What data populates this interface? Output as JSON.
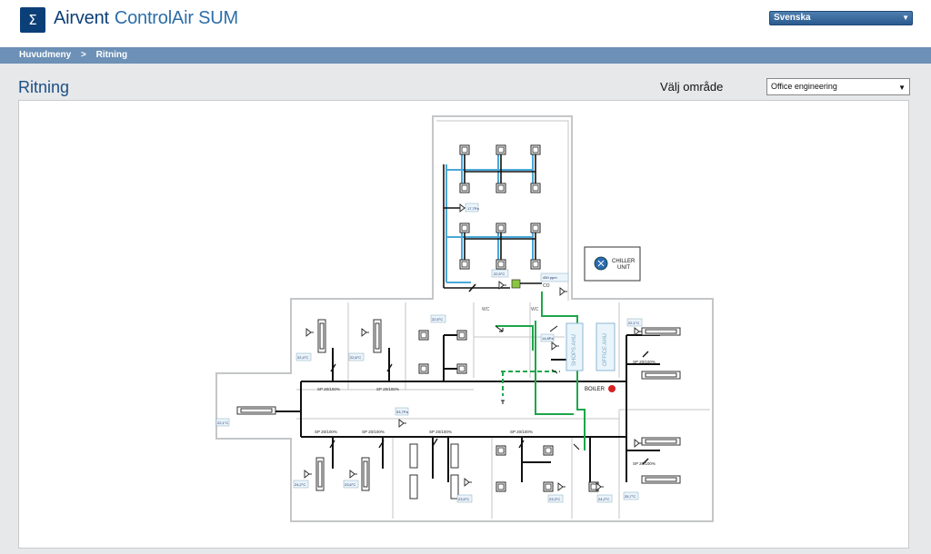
{
  "header": {
    "logo_symbol": "Σ",
    "brand_primary": "Airvent",
    "brand_secondary": "ControlAir SUM",
    "language_selected": "Svenska"
  },
  "breadcrumb": {
    "home": "Huvudmeny",
    "separator": ">",
    "current": "Ritning"
  },
  "page": {
    "title": "Ritning",
    "area_label": "Välj område",
    "area_selected": "Office engineering"
  },
  "drawing": {
    "chiller_line1": "CHILLER",
    "chiller_line2": "UNIT",
    "boiler_label": "BOILER",
    "wc_label": "WC",
    "co_label": "CO",
    "ppm_value": "450 ppm",
    "office_ahu": "OFFICE AHU",
    "shops_ahu": "SHOPS AHU",
    "temp_225": "22,5°C",
    "temp_226": "22,6°C",
    "temp_224": "22,4°C",
    "temp_221": "22,1°C",
    "temp_242": "24,2°C",
    "temp_236": "23,6°C",
    "temp_235": "23,5°C",
    "temp_233": "23,3°C",
    "temp_257": "25,7°C",
    "pa_176": "17,7Pa",
    "pa_148": "14,8Pa",
    "pa_53": "53,7Pa",
    "sp_label": "SP 20/100%",
    "colors": {
      "blue_duct": "#4aa8d8",
      "green_duct": "#1da64a",
      "black_duct": "#111111",
      "wall": "#c4c6c8",
      "boiler": "#d62020",
      "chiller_fan": "#2b6cb0"
    }
  }
}
